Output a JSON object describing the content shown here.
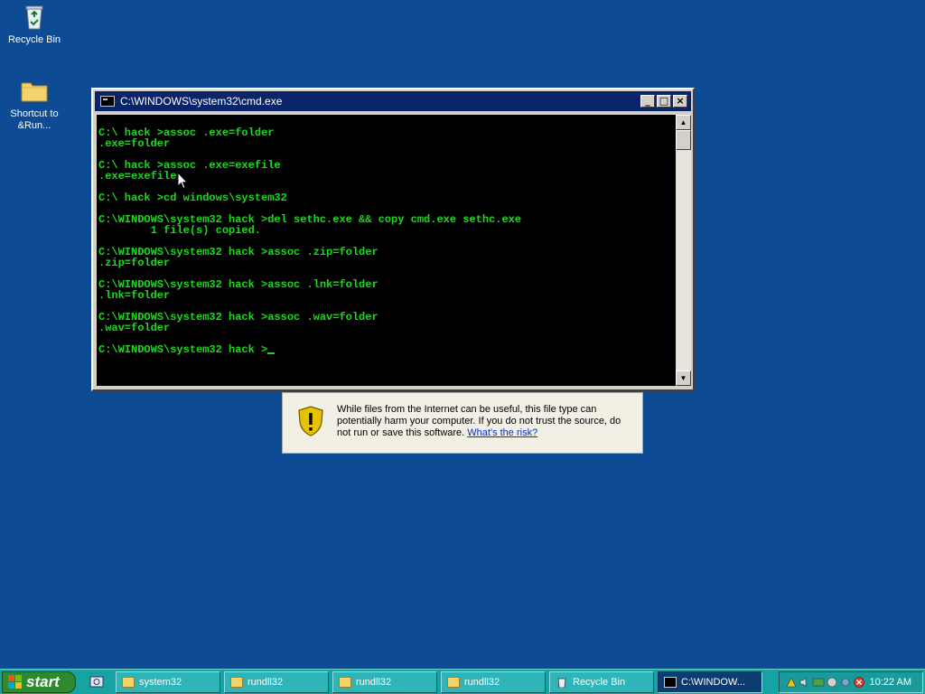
{
  "desktop": {
    "icons": [
      {
        "label": "Recycle Bin",
        "icon": "recycle-bin-icon"
      },
      {
        "label_line1": "Shortcut to",
        "label_line2": "&Run...",
        "icon": "folder-icon"
      }
    ]
  },
  "cmd_window": {
    "title": "C:\\WINDOWS\\system32\\cmd.exe",
    "buttons": {
      "minimize": "_",
      "maximize": "□",
      "close": "×"
    },
    "lines": [
      "C:\\ hack >assoc .exe=folder",
      ".exe=folder",
      "",
      "C:\\ hack >assoc .exe=exefile",
      ".exe=exefile",
      "",
      "C:\\ hack >cd windows\\system32",
      "",
      "C:\\WINDOWS\\system32 hack >del sethc.exe && copy cmd.exe sethc.exe",
      "        1 file(s) copied.",
      "",
      "C:\\WINDOWS\\system32 hack >assoc .zip=folder",
      ".zip=folder",
      "",
      "C:\\WINDOWS\\system32 hack >assoc .lnk=folder",
      ".lnk=folder",
      "",
      "C:\\WINDOWS\\system32 hack >assoc .wav=folder",
      ".wav=folder",
      ""
    ],
    "prompt": "C:\\WINDOWS\\system32 hack >"
  },
  "warning": {
    "message": "While files from the Internet can be useful, this file type can potentially harm your computer. If you do not trust the source, do not run or save this software.",
    "link": "What's the risk?"
  },
  "taskbar": {
    "start_label": "start",
    "tasks": [
      {
        "label": "system32",
        "icon": "folder-icon",
        "active": false
      },
      {
        "label": "rundll32",
        "icon": "folder-icon",
        "active": false
      },
      {
        "label": "rundll32",
        "icon": "folder-icon",
        "active": false
      },
      {
        "label": "rundll32",
        "icon": "folder-icon",
        "active": false
      },
      {
        "label": "Recycle Bin",
        "icon": "recycle-bin-icon",
        "active": false
      },
      {
        "label": "C:\\WINDOW...",
        "icon": "cmd-icon",
        "active": true
      }
    ],
    "clock": "10:22 AM"
  },
  "colors": {
    "desktop": "#0d4c94",
    "console_text": "#1bd81b",
    "titlebar": "#0a246a",
    "taskbar": "#17a2a4"
  }
}
